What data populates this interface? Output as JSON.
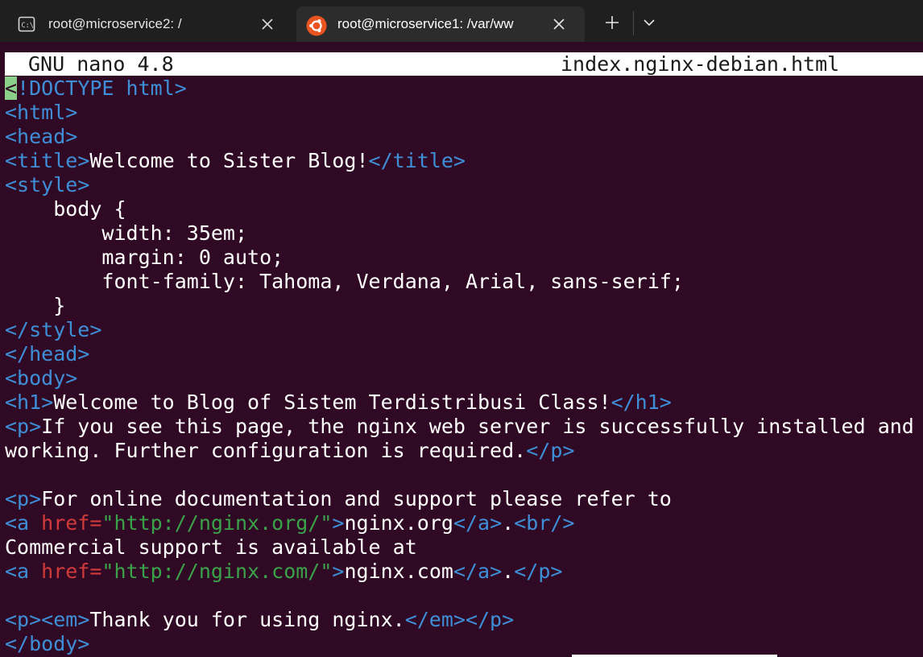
{
  "tabs": [
    {
      "title": "root@microservice2: /",
      "icon": "cmd-terminal-icon",
      "active": false
    },
    {
      "title": "root@microservice1: /var/ww",
      "icon": "ubuntu-icon",
      "active": true
    }
  ],
  "editor": {
    "name": "GNU nano 4.8",
    "filename": "index.nginx-debian.html"
  },
  "lines": [
    [
      {
        "t": "tag",
        "v": "<"
      },
      {
        "t": "tag",
        "v": "!DOCTYPE html>"
      }
    ],
    [
      {
        "t": "tag",
        "v": "<html>"
      }
    ],
    [
      {
        "t": "tag",
        "v": "<head>"
      }
    ],
    [
      {
        "t": "tag",
        "v": "<title>"
      },
      {
        "t": "txt",
        "v": "Welcome to Sister Blog!"
      },
      {
        "t": "tag",
        "v": "</title>"
      }
    ],
    [
      {
        "t": "tag",
        "v": "<style>"
      }
    ],
    [
      {
        "t": "txt",
        "v": "    body {"
      }
    ],
    [
      {
        "t": "txt",
        "v": "        width: 35em;"
      }
    ],
    [
      {
        "t": "txt",
        "v": "        margin: 0 auto;"
      }
    ],
    [
      {
        "t": "txt",
        "v": "        font-family: Tahoma, Verdana, Arial, sans-serif;"
      }
    ],
    [
      {
        "t": "txt",
        "v": "    }"
      }
    ],
    [
      {
        "t": "tag",
        "v": "</style>"
      }
    ],
    [
      {
        "t": "tag",
        "v": "</head>"
      }
    ],
    [
      {
        "t": "tag",
        "v": "<body>"
      }
    ],
    [
      {
        "t": "tag",
        "v": "<h1>"
      },
      {
        "t": "txt",
        "v": "Welcome to Blog of Sistem Terdistribusi Class!"
      },
      {
        "t": "tag",
        "v": "</h1>"
      }
    ],
    [
      {
        "t": "tag",
        "v": "<p>"
      },
      {
        "t": "txt",
        "v": "If you see this page, the nginx web server is successfully installed and"
      }
    ],
    [
      {
        "t": "txt",
        "v": "working. Further configuration is required."
      },
      {
        "t": "tag",
        "v": "</p>"
      }
    ],
    [],
    [
      {
        "t": "tag",
        "v": "<p>"
      },
      {
        "t": "txt",
        "v": "For online documentation and support please refer to"
      }
    ],
    [
      {
        "t": "tag",
        "v": "<a "
      },
      {
        "t": "attr",
        "v": "href="
      },
      {
        "t": "str",
        "v": "\"http://nginx.org/\""
      },
      {
        "t": "tag",
        "v": ">"
      },
      {
        "t": "txt",
        "v": "nginx.org"
      },
      {
        "t": "tag",
        "v": "</a>"
      },
      {
        "t": "txt",
        "v": "."
      },
      {
        "t": "tag",
        "v": "<br/>"
      }
    ],
    [
      {
        "t": "txt",
        "v": "Commercial support is available at"
      }
    ],
    [
      {
        "t": "tag",
        "v": "<a "
      },
      {
        "t": "attr",
        "v": "href="
      },
      {
        "t": "str",
        "v": "\"http://nginx.com/\""
      },
      {
        "t": "tag",
        "v": ">"
      },
      {
        "t": "txt",
        "v": "nginx.com"
      },
      {
        "t": "tag",
        "v": "</a>"
      },
      {
        "t": "txt",
        "v": "."
      },
      {
        "t": "tag",
        "v": "</p>"
      }
    ],
    [],
    [
      {
        "t": "tag",
        "v": "<p><em>"
      },
      {
        "t": "txt",
        "v": "Thank you for using nginx."
      },
      {
        "t": "tag",
        "v": "</em></p>"
      }
    ],
    [
      {
        "t": "tag",
        "v": "</body>"
      }
    ]
  ],
  "colors": {
    "background": "#300a24",
    "tag": "#3e8fd8",
    "text": "#ffffff",
    "attribute": "#d23a3a",
    "string": "#3aa34a",
    "cursor": "#8ad08a"
  }
}
